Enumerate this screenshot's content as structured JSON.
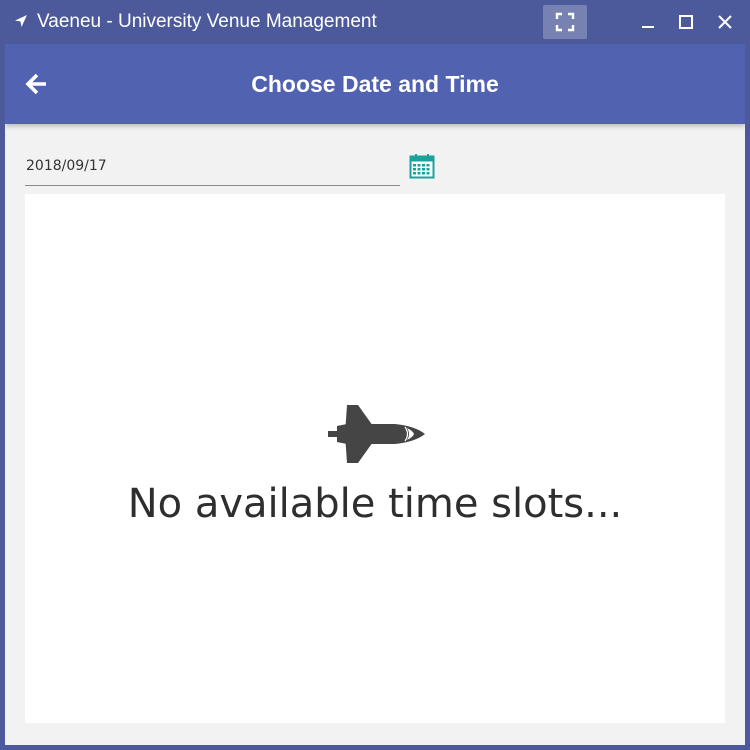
{
  "window": {
    "title": "Vaeneu - University Venue Management",
    "icons": {
      "app": "navigation-arrow-icon",
      "fullscreen": "fullscreen-icon",
      "minimize": "minimize-icon",
      "maximize": "maximize-icon",
      "close": "close-icon"
    }
  },
  "appbar": {
    "title": "Choose Date and Time",
    "back_icon": "arrow-left-icon"
  },
  "date_picker": {
    "value": "2018/09/17",
    "calendar_icon": "calendar-icon"
  },
  "time_slots": {
    "empty_message": "No available time slots...",
    "empty_icon": "space-shuttle-icon"
  },
  "colors": {
    "window_frame": "#4c5a9c",
    "appbar": "#5162b1",
    "calendar_icon": "#1aa39a",
    "background": "#f2f2f2",
    "panel": "#ffffff",
    "text_dark": "#2e2e2e"
  }
}
